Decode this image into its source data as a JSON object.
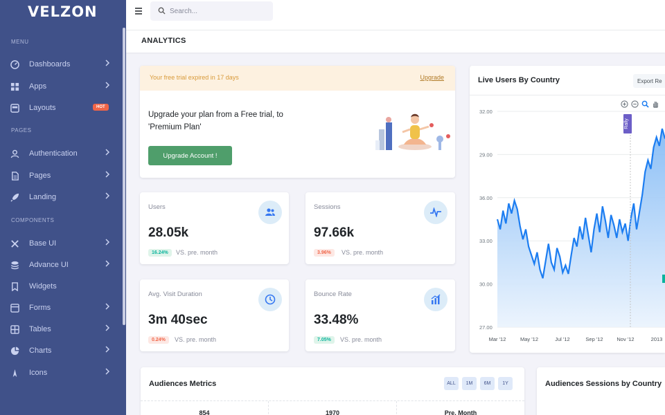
{
  "app": {
    "logo": "VELZON"
  },
  "sidebar": {
    "sections": {
      "menu": "MENU",
      "pages": "PAGES",
      "components": "COMPONENTS"
    },
    "items": [
      {
        "label": "Dashboards",
        "icon": "dashboard-icon",
        "chevron": true
      },
      {
        "label": "Apps",
        "icon": "apps-grid-icon",
        "chevron": true
      },
      {
        "label": "Layouts",
        "icon": "layouts-icon",
        "badge": "HOT"
      },
      {
        "label": "Authentication",
        "icon": "user-icon",
        "chevron": true
      },
      {
        "label": "Pages",
        "icon": "pages-icon",
        "chevron": true
      },
      {
        "label": "Landing",
        "icon": "rocket-icon",
        "chevron": true
      },
      {
        "label": "Base UI",
        "icon": "tools-icon",
        "chevron": true
      },
      {
        "label": "Advance UI",
        "icon": "stack-icon",
        "chevron": true
      },
      {
        "label": "Widgets",
        "icon": "bookmark-icon",
        "chevron": false
      },
      {
        "label": "Forms",
        "icon": "forms-icon",
        "chevron": true
      },
      {
        "label": "Tables",
        "icon": "table-icon",
        "chevron": true
      },
      {
        "label": "Charts",
        "icon": "pie-chart-icon",
        "chevron": true
      },
      {
        "label": "Icons",
        "icon": "compass-icon",
        "chevron": true
      }
    ]
  },
  "topbar": {
    "search_placeholder": "Search..."
  },
  "page": {
    "title": "ANALYTICS"
  },
  "trial": {
    "notice": "Your free trial expired in 17 days",
    "link": "Upgrade",
    "message": "Upgrade your plan from a Free trial, to 'Premium Plan'",
    "button": "Upgrade Account !"
  },
  "stats": [
    {
      "label": "Users",
      "value": "28.05k",
      "change": "16.24%",
      "direction": "up",
      "vs": "VS. pre. month",
      "icon": "users-icon"
    },
    {
      "label": "Sessions",
      "value": "97.66k",
      "change": "3.96%",
      "direction": "down",
      "vs": "VS. pre. month",
      "icon": "pulse-icon"
    },
    {
      "label": "Avg. Visit Duration",
      "value": "3m 40sec",
      "change": "0.24%",
      "direction": "down",
      "vs": "VS. pre. month",
      "icon": "clock-icon"
    },
    {
      "label": "Bounce Rate",
      "value": "33.48%",
      "change": "7.05%",
      "direction": "up",
      "vs": "VS. pre. month",
      "icon": "bar-chart-icon"
    }
  ],
  "live_users": {
    "title": "Live Users By Country",
    "export_label": "Export Re",
    "marker_label": "Rally",
    "y_ticks": [
      "32.00",
      "29.00",
      "36.00",
      "33.00",
      "30.00",
      "27.00"
    ],
    "x_ticks": [
      "Mar '12",
      "May '12",
      "Jul '12",
      "Sep '12",
      "Nov '12",
      "2013"
    ],
    "colors": {
      "line": "#1c7df1",
      "fill_top": "#7fb8f5",
      "fill_bottom": "#eaf3fd",
      "marker": "#6c5ec7"
    }
  },
  "chart_data": {
    "type": "area",
    "title": "",
    "xlabel": "",
    "ylabel": "",
    "y_tick_labels": [
      "32.00",
      "29.00",
      "36.00",
      "33.00",
      "30.00",
      "27.00"
    ],
    "x_tick_labels": [
      "Mar '12",
      "May '12",
      "Jul '12",
      "Sep '12",
      "Nov '12",
      "2013"
    ],
    "ylim": [
      27,
      42
    ],
    "grid": true,
    "series": [
      {
        "values": [
          34.5,
          33.8,
          35.1,
          34.2,
          35.6,
          34.9,
          35.8,
          35.2,
          34.0,
          33.1,
          33.8,
          32.6,
          32.0,
          31.4,
          32.2,
          31.0,
          30.4,
          31.6,
          32.8,
          31.5,
          31.0,
          32.5,
          31.9,
          30.8,
          31.3,
          30.7,
          32.0,
          33.2,
          32.6,
          34.0,
          33.1,
          34.6,
          33.4,
          32.2,
          33.8,
          34.9,
          33.6,
          35.4,
          34.4,
          33.2,
          34.8,
          34.1,
          33.2,
          34.5,
          33.6,
          34.2,
          33.0,
          34.6,
          35.6,
          33.8,
          35.0,
          36.2,
          37.8,
          38.6,
          38.0,
          39.5,
          40.2,
          39.6,
          40.8,
          40.1
        ]
      }
    ]
  },
  "audiences": {
    "title": "Audiences Metrics",
    "filters": [
      "ALL",
      "1M",
      "6M",
      "1Y"
    ],
    "row": [
      "854",
      "1970",
      "Pre. Month"
    ]
  },
  "sessions_card": {
    "title": "Audiences Sessions by Country"
  }
}
